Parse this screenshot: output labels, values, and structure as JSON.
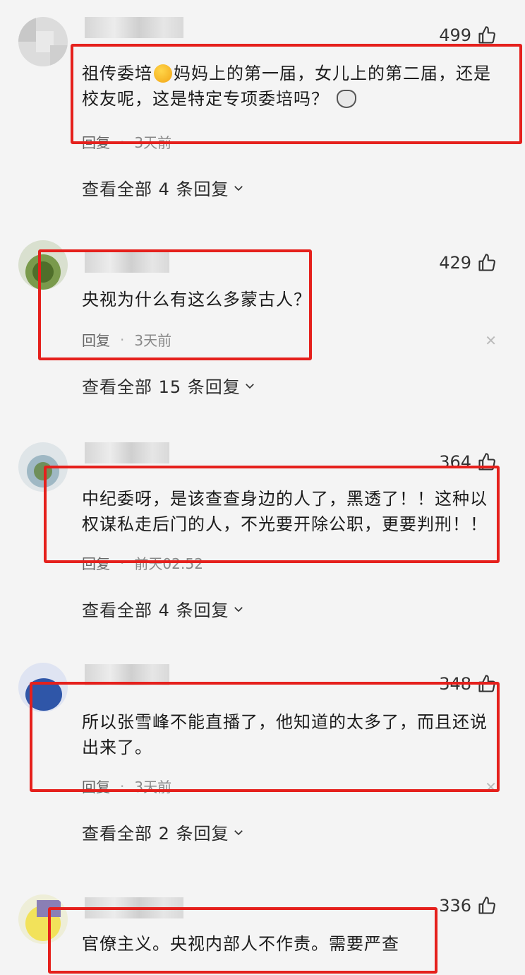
{
  "comments": [
    {
      "likes": "499",
      "text_a": "祖传委培",
      "text_b": "妈妈上的第一届，女儿上的第二届，还是校友呢，这是特定专项委培吗？",
      "reply_label": "回复",
      "time": "3天前",
      "view_more": "查看全部 4 条回复"
    },
    {
      "likes": "429",
      "text": "央视为什么有这么多蒙古人？",
      "reply_label": "回复",
      "time": "3天前",
      "view_more": "查看全部 15 条回复"
    },
    {
      "likes": "364",
      "text": "中纪委呀，是该查查身边的人了，黑透了！！这种以权谋私走后门的人，不光要开除公职，更要判刑！！",
      "reply_label": "回复",
      "time": "前天02:52",
      "view_more": "查看全部 4 条回复"
    },
    {
      "likes": "348",
      "text": "所以张雪峰不能直播了，他知道的太多了，而且还说出来了。",
      "reply_label": "回复",
      "time": "3天前",
      "view_more": "查看全部 2 条回复"
    },
    {
      "likes": "336",
      "text": "官僚主义。央视内部人不作责。需要严查"
    }
  ],
  "icons": {
    "like": "thumbs-up-icon",
    "close": "close-icon",
    "chevron": "chevron-down-icon"
  },
  "colors": {
    "highlight_box": "#e5201c",
    "background": "#f4f4f4"
  }
}
